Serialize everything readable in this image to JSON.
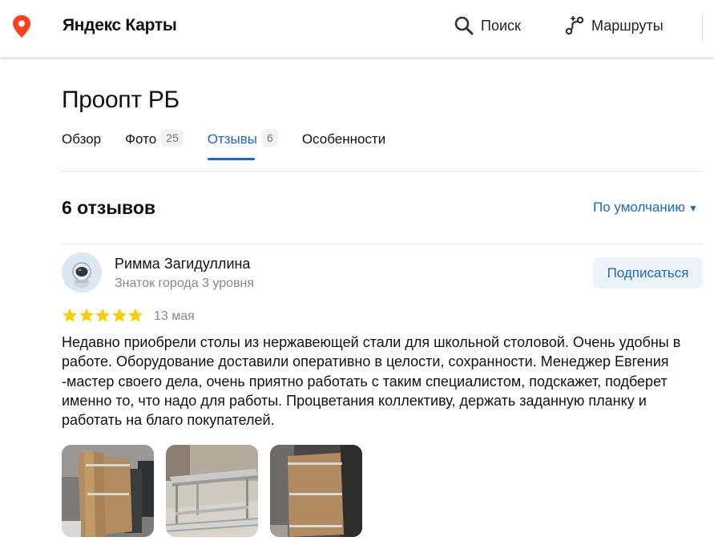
{
  "header": {
    "brand": "Яндекс Карты",
    "search_label": "Поиск",
    "routes_label": "Маршруты",
    "brand_color": "#fc3f1d"
  },
  "place": {
    "title": "Проопт РБ"
  },
  "tabs": [
    {
      "label": "Обзор",
      "count": ""
    },
    {
      "label": "Фото",
      "count": "25"
    },
    {
      "label": "Отзывы",
      "count": "6",
      "active": true
    },
    {
      "label": "Особенности",
      "count": ""
    }
  ],
  "reviews": {
    "count_label": "6 отзывов",
    "sort_label": "По умолчанию",
    "items": [
      {
        "author": "Римма Загидуллина",
        "level": "Знаток города 3 уровня",
        "subscribe_label": "Подписаться",
        "rating": 5,
        "date": "13 мая",
        "text": "Недавно приобрели столы из нержавеющей стали для школьной столовой. Очень удобны в работе. Оборудование доставили оперативно в целости, сохранности. Менеджер Евгения -мастер своего дела, очень приятно работать с таким специалистом, подскажет, подберет именно то, что надо для работы. Процветания коллективу, держать заданную планку и работать на благо покупателей.",
        "photos": [
          "photo-cardboard-boxes",
          "photo-steel-table",
          "photo-wrapped-box"
        ]
      }
    ]
  },
  "colors": {
    "accent": "#1967d2",
    "star": "#fc0",
    "muted": "#888888"
  }
}
